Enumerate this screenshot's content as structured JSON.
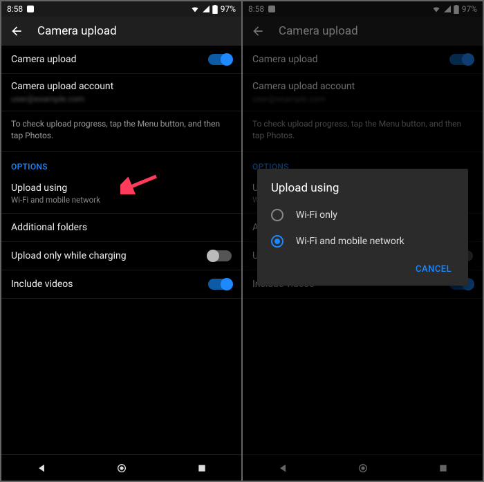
{
  "status": {
    "time": "8:58",
    "battery": "97%"
  },
  "appbar": {
    "title": "Camera upload"
  },
  "settings": {
    "camera_upload": "Camera upload",
    "account_title": "Camera upload account",
    "account_value": "user@example.com",
    "info": "To check upload progress, tap the Menu button, and then tap Photos.",
    "options_header": "OPTIONS",
    "upload_using_title": "Upload using",
    "upload_using_value": "Wi-Fi and mobile network",
    "additional_folders": "Additional folders",
    "upload_charging": "Upload only while charging",
    "include_videos": "Include videos"
  },
  "dialog": {
    "title": "Upload using",
    "option_wifi": "Wi-Fi only",
    "option_both": "Wi-Fi and mobile network",
    "cancel": "CANCEL"
  },
  "colors": {
    "accent": "#1e88ff",
    "arrow": "#ff3b5b"
  }
}
